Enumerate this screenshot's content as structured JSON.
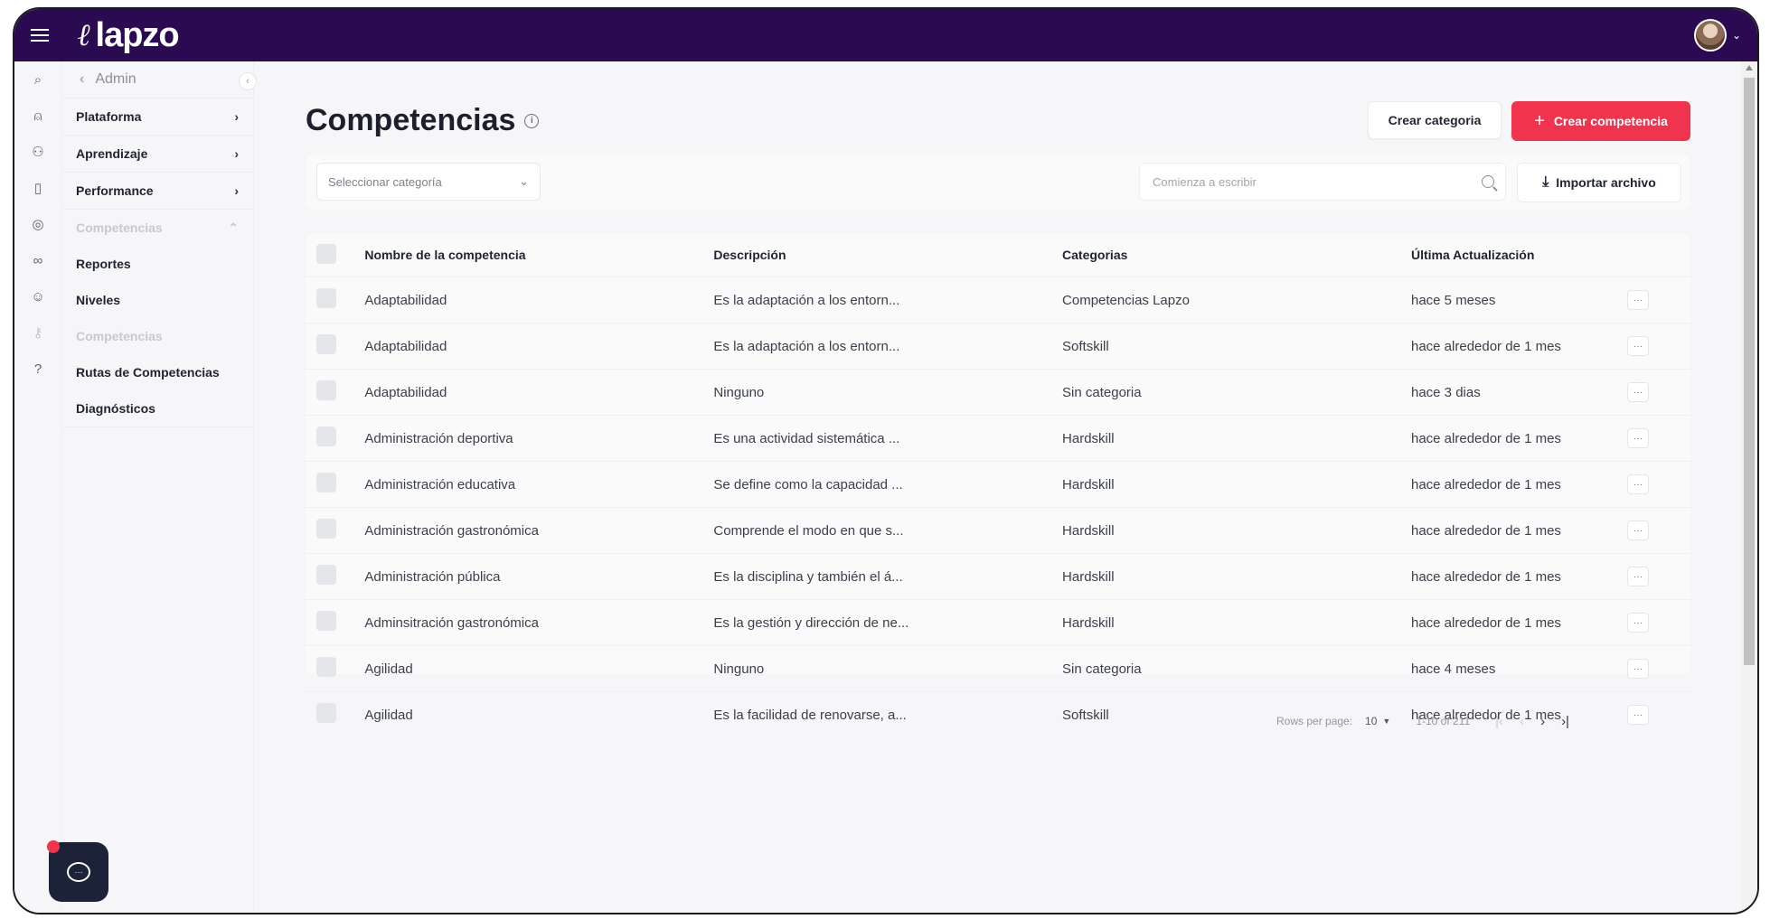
{
  "app": {
    "brand": "lapzo",
    "logo_glyph": "ℓ"
  },
  "sidebar": {
    "header": "Admin",
    "items": [
      {
        "label": "Plataforma",
        "chevron": "›",
        "state": "normal"
      },
      {
        "label": "Aprendizaje",
        "chevron": "›",
        "state": "normal"
      },
      {
        "label": "Performance",
        "chevron": "›",
        "state": "normal"
      },
      {
        "label": "Competencias",
        "chevron": "⌃",
        "state": "dim"
      },
      {
        "label": "Reportes",
        "state": "sub"
      },
      {
        "label": "Niveles",
        "state": "sub"
      },
      {
        "label": "Competencias",
        "state": "dim-sub"
      },
      {
        "label": "Rutas de Competencias",
        "state": "sub"
      },
      {
        "label": "Diagnósticos",
        "state": "sub"
      }
    ]
  },
  "page": {
    "title": "Competencias",
    "actions": {
      "secondary": "Crear categoria",
      "primary": "Crear competencia"
    }
  },
  "filters": {
    "category_select": "Seleccionar categoría",
    "search_placeholder": "Comienza a escribir",
    "import_label": "Importar archivo"
  },
  "table": {
    "columns": [
      "Nombre de la competencia",
      "Descripción",
      "Categorias",
      "Última Actualización"
    ],
    "rows": [
      {
        "name": "Adaptabilidad",
        "desc": "Es la adaptación a los entorn...",
        "category": "Competencias Lapzo",
        "updated": "hace 5 meses"
      },
      {
        "name": "Adaptabilidad",
        "desc": "Es la adaptación a los entorn...",
        "category": "Softskill",
        "updated": "hace alrededor de 1 mes"
      },
      {
        "name": "Adaptabilidad",
        "desc": "Ninguno",
        "category": "Sin categoria",
        "updated": "hace 3 dias"
      },
      {
        "name": "Administración deportiva",
        "desc": "Es una actividad sistemática ...",
        "category": "Hardskill",
        "updated": "hace alrededor de 1 mes"
      },
      {
        "name": "Administración educativa",
        "desc": "Se define como la capacidad ...",
        "category": "Hardskill",
        "updated": "hace alrededor de 1 mes"
      },
      {
        "name": "Administración gastronómica",
        "desc": "Comprende el modo en que s...",
        "category": "Hardskill",
        "updated": "hace alrededor de 1 mes"
      },
      {
        "name": "Administración pública",
        "desc": "Es la disciplina y también el á...",
        "category": "Hardskill",
        "updated": "hace alrededor de 1 mes"
      },
      {
        "name": "Adminsitración gastronómica",
        "desc": "Es la gestión y dirección de ne...",
        "category": "Hardskill",
        "updated": "hace alrededor de 1 mes"
      },
      {
        "name": "Agilidad",
        "desc": "Ninguno",
        "category": "Sin categoria",
        "updated": "hace 4 meses"
      },
      {
        "name": "Agilidad",
        "desc": "Es la facilidad de renovarse, a...",
        "category": "Softskill",
        "updated": "hace alrededor de 1 mes"
      }
    ],
    "more_label": "···"
  },
  "pagination": {
    "rows_per_page_label": "Rows per page:",
    "rows_per_page_value": "10",
    "range": "1-10 of 211"
  },
  "colors": {
    "topbar": "#2a0b52",
    "primary": "#f0344e"
  }
}
